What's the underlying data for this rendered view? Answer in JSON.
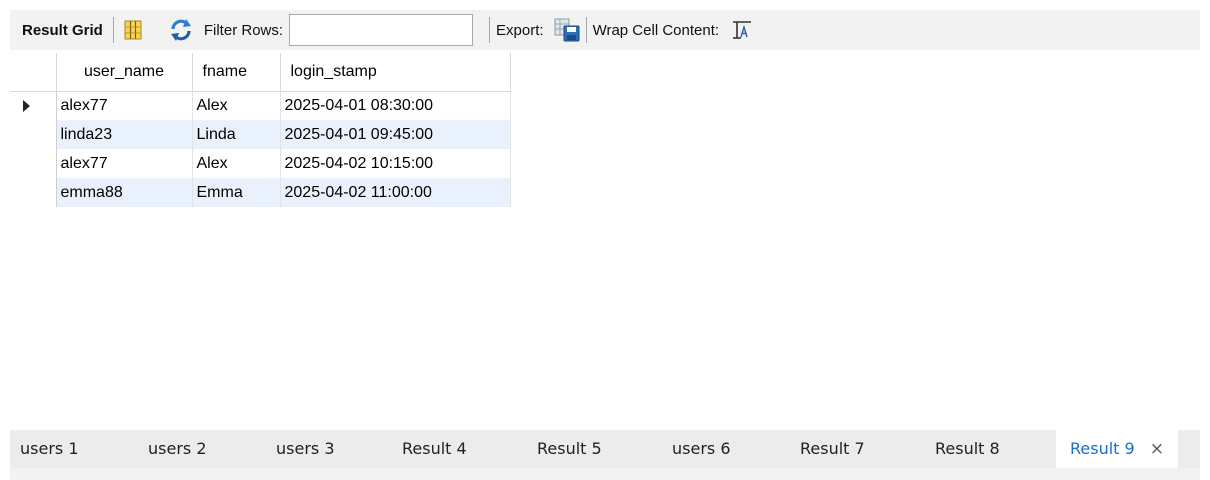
{
  "toolbar": {
    "result_grid_label": "Result Grid",
    "filter_rows_label": "Filter Rows:",
    "filter_rows_value": "",
    "export_label": "Export:",
    "wrap_label": "Wrap Cell Content:",
    "icons": [
      "grid-columns-icon",
      "refresh-icon",
      "export-icon",
      "wrap-text-icon"
    ]
  },
  "grid": {
    "columns": [
      "user_name",
      "fname",
      "login_stamp"
    ],
    "rows": [
      {
        "user_name": "alex77",
        "fname": "Alex",
        "login_stamp": "2025-04-01 08:30:00"
      },
      {
        "user_name": "linda23",
        "fname": "Linda",
        "login_stamp": "2025-04-01 09:45:00"
      },
      {
        "user_name": "alex77",
        "fname": "Alex",
        "login_stamp": "2025-04-02 10:15:00"
      },
      {
        "user_name": "emma88",
        "fname": "Emma",
        "login_stamp": "2025-04-02 11:00:00"
      }
    ]
  },
  "tabs": {
    "items": [
      "users 1",
      "users 2",
      "users 3",
      "Result 4",
      "Result 5",
      "users 6",
      "Result 7",
      "Result 8",
      "Result 9"
    ],
    "active": "Result 9",
    "close_glyph": "×"
  },
  "colors": {
    "active_tab_text": "#1a6fc9",
    "alt_row_bg": "#e9f2fc",
    "toolbar_bg": "#f2f2f2"
  }
}
